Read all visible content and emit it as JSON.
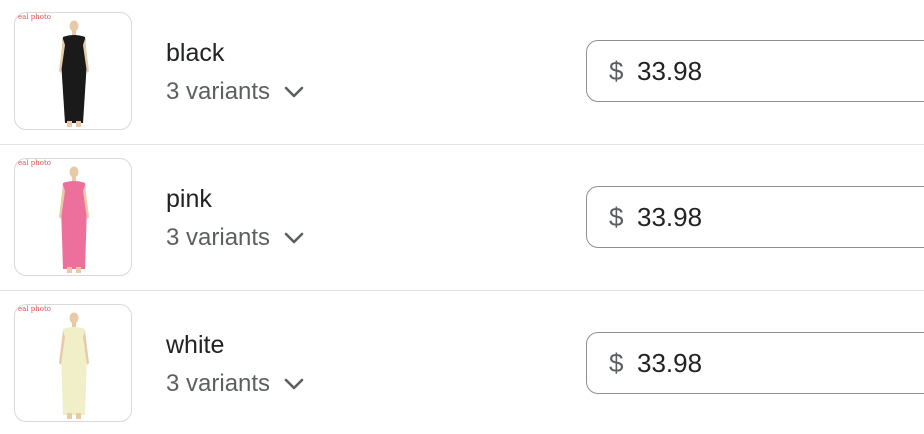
{
  "rows": [
    {
      "name": "black",
      "variants_label": "3 variants",
      "currency": "$",
      "price": "33.98",
      "dress_color": "#1a1a1a",
      "watermark": "eal photo"
    },
    {
      "name": "pink",
      "variants_label": "3 variants",
      "currency": "$",
      "price": "33.98",
      "dress_color": "#ec6f9c",
      "watermark": "eal photo"
    },
    {
      "name": "white",
      "variants_label": "3 variants",
      "currency": "$",
      "price": "33.98",
      "dress_color": "#f1efc8",
      "watermark": "eal photo"
    }
  ]
}
